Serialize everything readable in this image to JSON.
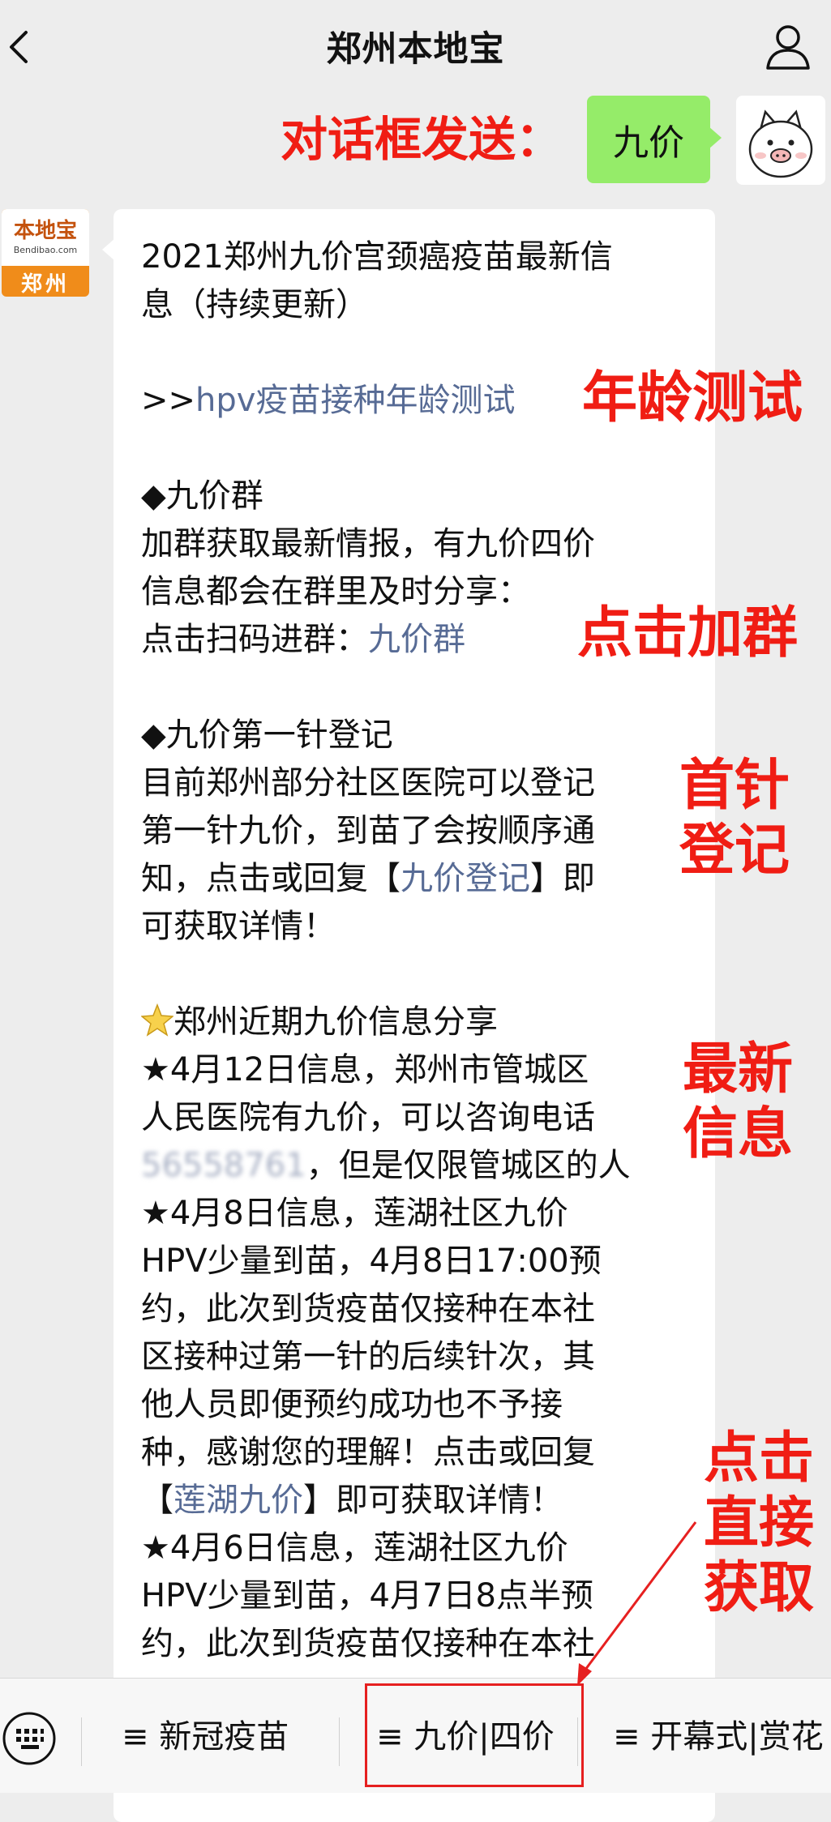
{
  "header": {
    "title": "郑州本地宝"
  },
  "annotations": {
    "send_prompt": "对话框发送：",
    "age_test": "年龄测试",
    "join_group": "点击加群",
    "first_dose": [
      "首针",
      "登记"
    ],
    "latest_info": [
      "最新",
      "信息"
    ],
    "click_direct": [
      "点击",
      "直接",
      "获取"
    ]
  },
  "sent_message": "九价",
  "bot_avatar": {
    "logo": "本地宝",
    "url": "Bendibao.com",
    "city": "郑州"
  },
  "message": {
    "title_1": "2021郑州九价宫颈癌疫苗最新信",
    "title_2": "息（持续更新）",
    "age_test_prefix": ">>",
    "age_test_link": "hpv疫苗接种年龄测试",
    "group_heading": "◆九价群",
    "group_line_1": "加群获取最新情报，有九价四价",
    "group_line_2": "信息都会在群里及时分享：",
    "group_line_3_prefix": "点击扫码进群：",
    "group_link": "九价群",
    "register_heading": "◆九价第一针登记",
    "register_line_1": "目前郑州部分社区医院可以登记",
    "register_line_2": "第一针九价，到苗了会按顺序通",
    "register_line_3_prefix": "知，点击或回复【",
    "register_link": "九价登记",
    "register_line_3_suffix": "】即",
    "register_line_4": "可获取详情！",
    "share_heading": "郑州近期九价信息分享",
    "info1_line_1": "★4月12日信息，郑州市管城区",
    "info1_line_2": "人民医院有九价，可以咨询电话",
    "info1_phone_blurred": "56558761",
    "info1_line_3_suffix": "，但是仅限管城区的人",
    "info2_line_1": "★4月8日信息，莲湖社区九价",
    "info2_line_2": "HPV少量到苗，4月8日17:00预",
    "info2_line_3": "约，此次到货疫苗仅接种在本社",
    "info2_line_4": "区接种过第一针的后续针次，其",
    "info2_line_5": "他人员即便预约成功也不予接",
    "info2_line_6": "种，感谢您的理解！点击或回复",
    "info2_line_7_prefix": "【",
    "info2_link": "莲湖九价",
    "info2_line_7_suffix": "】即可获取详情！",
    "info3_line_1": "★4月6日信息，莲湖社区九价",
    "info3_line_2": "HPV少量到苗，4月7日8点半预",
    "info3_line_3": "约，此次到货疫苗仅接种在本社"
  },
  "bottom_menu": {
    "items": [
      "≡ 新冠疫苗",
      "≡ 九价|四价",
      "≡ 开幕式|赏花"
    ]
  },
  "colors": {
    "annotation": "#f01d14",
    "link": "#576b95",
    "sent_bubble": "#95ec69"
  }
}
